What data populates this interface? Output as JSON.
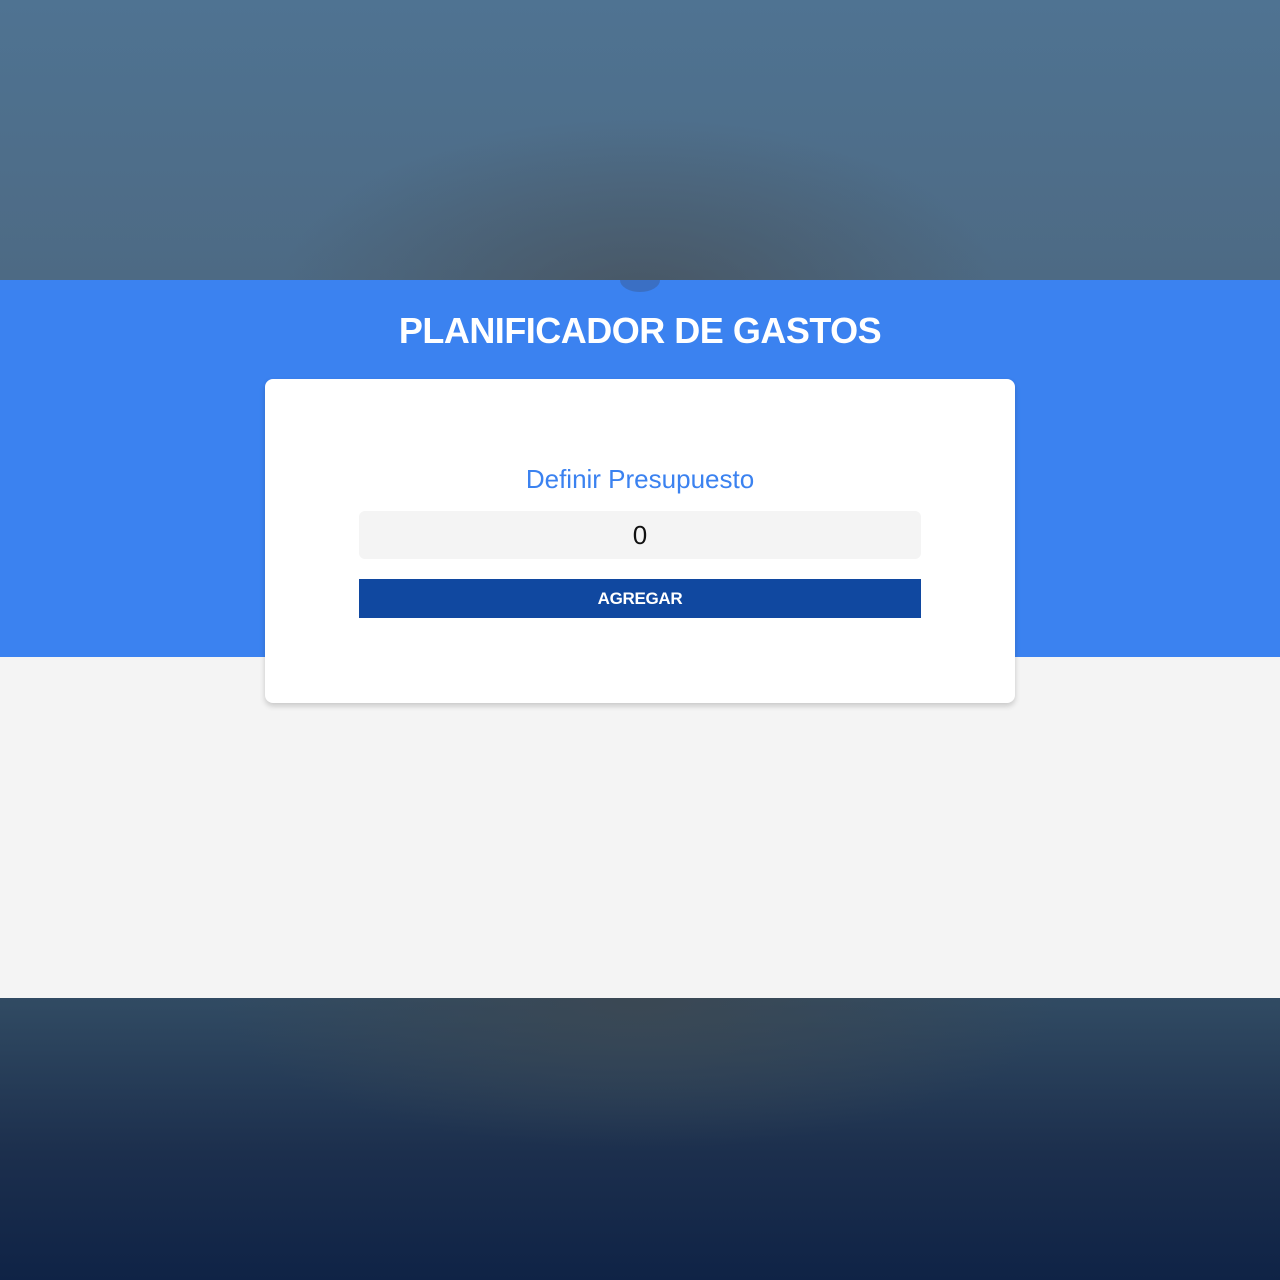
{
  "header": {
    "title": "PLANIFICADOR DE GASTOS"
  },
  "budget_form": {
    "label": "Definir Presupuesto",
    "input_value": "0",
    "submit_label": "AGREGAR"
  },
  "colors": {
    "primary_blue": "#3b82f0",
    "button_dark_blue": "#1048a0",
    "page_background": "#f4f4f4",
    "card_background": "#ffffff"
  }
}
